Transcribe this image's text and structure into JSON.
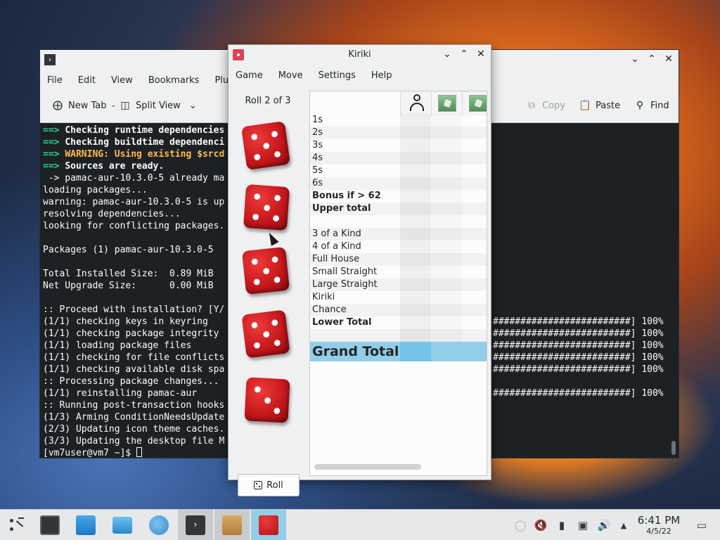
{
  "konsole": {
    "menu": [
      "File",
      "Edit",
      "View",
      "Bookmarks",
      "Plugi"
    ],
    "toolbar": {
      "new_tab": "New Tab",
      "split_view": "Split View",
      "copy": "Copy",
      "paste": "Paste",
      "find": "Find"
    },
    "lines": [
      {
        "arrow": "==> ",
        "text": "Checking runtime dependencies",
        "style": "bold"
      },
      {
        "arrow": "==> ",
        "text": "Checking buildtime dependenci",
        "style": "bold"
      },
      {
        "arrow": "==> ",
        "text": "WARNING: Using existing $srcd",
        "style": "warn"
      },
      {
        "arrow": "==> ",
        "text": "Sources are ready.",
        "style": "bold"
      },
      {
        "arrow": "",
        "text": " -> pamac-aur-10.3.0-5 already ma",
        "style": ""
      },
      {
        "arrow": "",
        "text": "loading packages...",
        "style": ""
      },
      {
        "arrow": "",
        "text": "warning: pamac-aur-10.3.0-5 is up",
        "style": ""
      },
      {
        "arrow": "",
        "text": "resolving dependencies...",
        "style": ""
      },
      {
        "arrow": "",
        "text": "looking for conflicting packages.",
        "style": ""
      },
      {
        "arrow": "",
        "text": "",
        "style": ""
      },
      {
        "arrow": "",
        "text": "Packages (1) pamac-aur-10.3.0-5",
        "style": ""
      },
      {
        "arrow": "",
        "text": "",
        "style": ""
      },
      {
        "arrow": "",
        "text": "Total Installed Size:  0.89 MiB",
        "style": ""
      },
      {
        "arrow": "",
        "text": "Net Upgrade Size:      0.00 MiB",
        "style": ""
      },
      {
        "arrow": "",
        "text": "",
        "style": ""
      },
      {
        "arrow": "",
        "text": ":: Proceed with installation? [Y/",
        "style": ""
      },
      {
        "arrow": "",
        "text": "(1/1) checking keys in keyring",
        "style": ""
      },
      {
        "arrow": "",
        "text": "(1/1) checking package integrity",
        "style": ""
      },
      {
        "arrow": "",
        "text": "(1/1) loading package files",
        "style": ""
      },
      {
        "arrow": "",
        "text": "(1/1) checking for file conflicts",
        "style": ""
      },
      {
        "arrow": "",
        "text": "(1/1) checking available disk spa",
        "style": ""
      },
      {
        "arrow": "",
        "text": ":: Processing package changes...",
        "style": ""
      },
      {
        "arrow": "",
        "text": "(1/1) reinstalling pamac-aur",
        "style": ""
      },
      {
        "arrow": "",
        "text": ":: Running post-transaction hooks",
        "style": ""
      },
      {
        "arrow": "",
        "text": "(1/3) Arming ConditionNeedsUpdate",
        "style": ""
      },
      {
        "arrow": "",
        "text": "(2/3) Updating icon theme caches.",
        "style": ""
      },
      {
        "arrow": "",
        "text": "(3/3) Updating the desktop file M",
        "style": ""
      }
    ],
    "prompt": "[vm7user@vm7 ~]$ ",
    "progress_text": "#########################] 100%",
    "progress_rows": [
      16,
      17,
      18,
      19,
      20,
      22
    ]
  },
  "kiriki": {
    "title": "Kiriki",
    "menu": [
      "Game",
      "Move",
      "Settings",
      "Help"
    ],
    "roll_label": "Roll 2 of 3",
    "roll_button": "Roll",
    "dice": [
      5,
      5,
      5,
      5,
      3
    ],
    "rows": [
      {
        "label": "1s",
        "bold": false
      },
      {
        "label": "2s",
        "bold": false
      },
      {
        "label": "3s",
        "bold": false
      },
      {
        "label": "4s",
        "bold": false
      },
      {
        "label": "5s",
        "bold": false
      },
      {
        "label": "6s",
        "bold": false
      },
      {
        "label": "Bonus if > 62",
        "bold": true
      },
      {
        "label": "Upper total",
        "bold": true
      },
      {
        "label": "",
        "bold": false
      },
      {
        "label": "3 of a Kind",
        "bold": false
      },
      {
        "label": "4 of a Kind",
        "bold": false
      },
      {
        "label": "Full House",
        "bold": false
      },
      {
        "label": "Small Straight",
        "bold": false
      },
      {
        "label": "Large Straight",
        "bold": false
      },
      {
        "label": "Kiriki",
        "bold": false
      },
      {
        "label": "Chance",
        "bold": false
      },
      {
        "label": "Lower Total",
        "bold": true
      },
      {
        "label": "",
        "bold": false
      }
    ],
    "grand_total": "Grand Total"
  },
  "clock": {
    "time": "6:41 PM",
    "date": "4/5/22"
  }
}
